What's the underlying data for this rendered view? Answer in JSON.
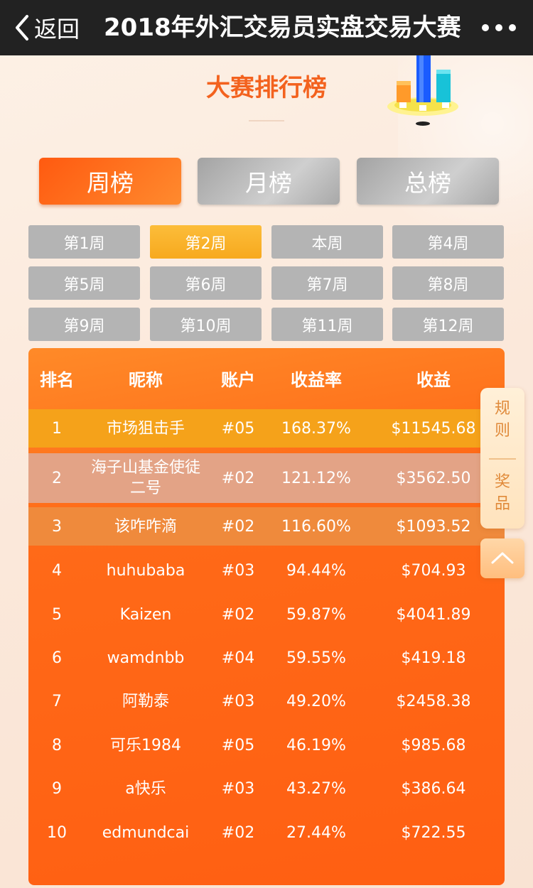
{
  "navbar": {
    "back_label": "返回",
    "title": "2018年外汇交易员实盘交易大赛",
    "more_icon": "more-dots-icon"
  },
  "header": {
    "title": "大赛排行榜"
  },
  "main_tabs": [
    {
      "label": "周榜",
      "active": true
    },
    {
      "label": "月榜",
      "active": false
    },
    {
      "label": "总榜",
      "active": false
    }
  ],
  "week_tabs": [
    {
      "label": "第1周",
      "active": false
    },
    {
      "label": "第2周",
      "active": true
    },
    {
      "label": "本周",
      "active": false
    },
    {
      "label": "第4周",
      "active": false
    },
    {
      "label": "第5周",
      "active": false
    },
    {
      "label": "第6周",
      "active": false
    },
    {
      "label": "第7周",
      "active": false
    },
    {
      "label": "第8周",
      "active": false
    },
    {
      "label": "第9周",
      "active": false
    },
    {
      "label": "第10周",
      "active": false
    },
    {
      "label": "第11周",
      "active": false
    },
    {
      "label": "第12周",
      "active": false
    }
  ],
  "table": {
    "headers": {
      "rank": "排名",
      "nickname": "昵称",
      "account": "账户",
      "rate": "收益率",
      "profit": "收益"
    },
    "rows": [
      {
        "rank": "1",
        "nickname": "市场狙击手",
        "account": "#05",
        "rate": "168.37%",
        "profit": "$11545.68"
      },
      {
        "rank": "2",
        "nickname": "海子山基金使徒二号",
        "account": "#02",
        "rate": "121.12%",
        "profit": "$3562.50"
      },
      {
        "rank": "3",
        "nickname": "该咋咋滴",
        "account": "#02",
        "rate": "116.60%",
        "profit": "$1093.52"
      },
      {
        "rank": "4",
        "nickname": "huhubaba",
        "account": "#03",
        "rate": "94.44%",
        "profit": "$704.93"
      },
      {
        "rank": "5",
        "nickname": "Kaizen",
        "account": "#02",
        "rate": "59.87%",
        "profit": "$4041.89"
      },
      {
        "rank": "6",
        "nickname": "wamdnbb",
        "account": "#04",
        "rate": "59.55%",
        "profit": "$419.18"
      },
      {
        "rank": "7",
        "nickname": "阿勒泰",
        "account": "#03",
        "rate": "49.20%",
        "profit": "$2458.38"
      },
      {
        "rank": "8",
        "nickname": "可乐1984",
        "account": "#05",
        "rate": "46.19%",
        "profit": "$985.68"
      },
      {
        "rank": "9",
        "nickname": "a快乐",
        "account": "#03",
        "rate": "43.27%",
        "profit": "$386.64"
      },
      {
        "rank": "10",
        "nickname": "edmundcai",
        "account": "#02",
        "rate": "27.44%",
        "profit": "$722.55"
      }
    ]
  },
  "side_panel": {
    "rules_label_1": "规",
    "rules_label_2": "则",
    "prize_label_1": "奖",
    "prize_label_2": "品",
    "top_icon": "chevron-up-icon"
  },
  "colors": {
    "navbar": "#222222",
    "accent_orange": "#ff6a18",
    "title_orange": "#f3621e",
    "week_active": "#f7a91e",
    "week_inactive": "#b4b4b4",
    "row1": "#f5a21a",
    "row2": "#e3a386",
    "row3": "#ef8a3c"
  }
}
